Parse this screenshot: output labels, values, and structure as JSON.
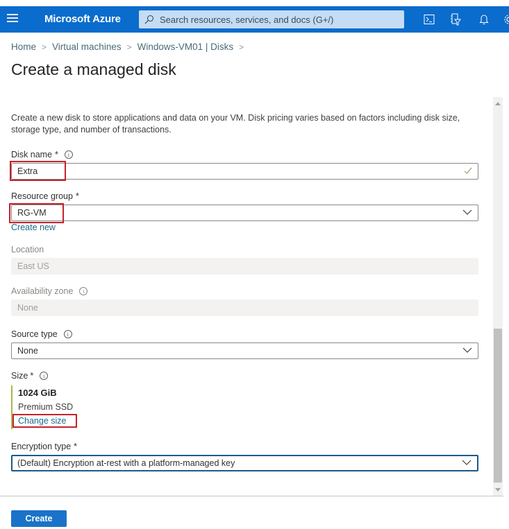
{
  "topbar": {
    "brand": "Microsoft Azure",
    "search_placeholder": "Search resources, services, and docs (G+/)",
    "icons": [
      "menu-icon",
      "cloud-shell-icon",
      "directory-filter-icon",
      "notifications-icon",
      "settings-icon"
    ],
    "color": "#1a73c8"
  },
  "breadcrumb": [
    {
      "label": "Home"
    },
    {
      "label": "Virtual machines"
    },
    {
      "label": "Windows-VM01 | Disks"
    }
  ],
  "page": {
    "title": "Create a managed disk",
    "description": "Create a new disk to store applications and data on your VM. Disk pricing varies based on factors including disk size, storage type, and number of transactions."
  },
  "form": {
    "disk_name": {
      "label": "Disk name",
      "required": "*",
      "value": "Extra",
      "valid": true
    },
    "resource_group": {
      "label": "Resource group",
      "required": "*",
      "value": "RG-VM",
      "create_new": "Create new"
    },
    "location": {
      "label": "Location",
      "value": "East US",
      "disabled": true
    },
    "availability_zone": {
      "label": "Availability zone",
      "value": "None",
      "disabled": true
    },
    "source_type": {
      "label": "Source type",
      "value": "None"
    },
    "size": {
      "label": "Size",
      "required": "*",
      "value": "1024 GiB",
      "type": "Premium SSD",
      "change_link": "Change size"
    },
    "encryption_type": {
      "label": "Encryption type",
      "required": "*",
      "value": "(Default) Encryption at-rest with a platform-managed key"
    }
  },
  "footer": {
    "create_label": "Create"
  },
  "highlight_color": "#c8202b"
}
